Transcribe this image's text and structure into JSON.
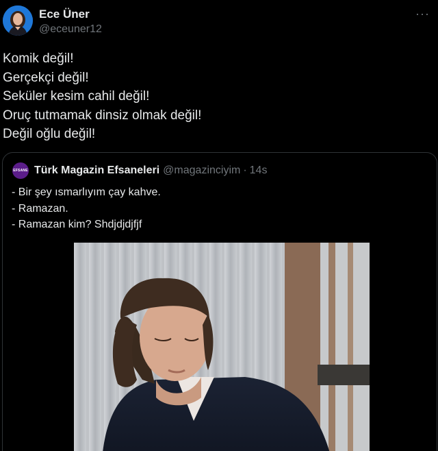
{
  "tweet": {
    "author": {
      "display_name": "Ece Üner",
      "handle": "@eceuner12",
      "avatar_icon": "user-avatar-photo"
    },
    "more_icon": "more-horizontal-icon",
    "lines": [
      "Komik değil!",
      "Gerçekçi değil!",
      "Seküler kesim cahil değil!",
      "Oruç tutmamak dinsiz olmak değil!",
      "Değil oğlu değil!"
    ]
  },
  "quote": {
    "author": {
      "display_name": "Türk Magazin Efsaneleri",
      "handle": "@magazinciyim",
      "separator": "·",
      "time": "14s",
      "avatar_label": "EFSANE",
      "avatar_color": "#5b1d8a"
    },
    "lines": [
      "- Bir şey ısmarlıyım çay kahve.",
      "- Ramazan.",
      "- Ramazan kim? Shdjdjdjfjf"
    ],
    "media": {
      "type": "image",
      "description_icon": "video-still-image"
    }
  },
  "colors": {
    "background": "#000000",
    "text_primary": "#e7e9ea",
    "text_secondary": "#71767b",
    "border": "#2f3336"
  }
}
